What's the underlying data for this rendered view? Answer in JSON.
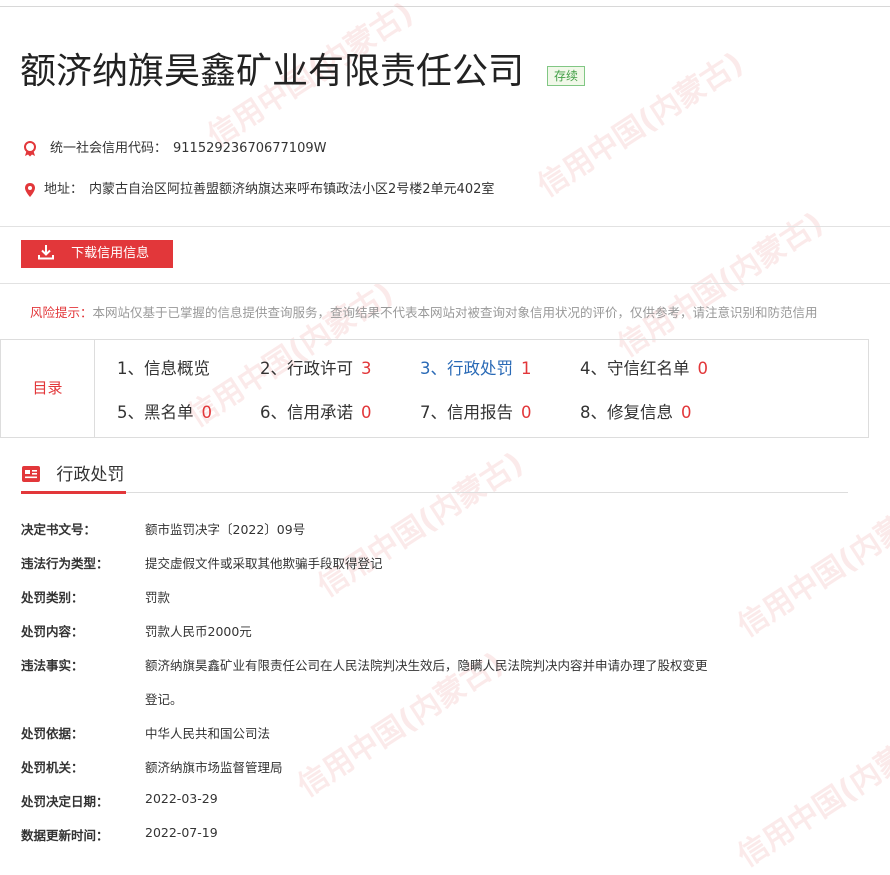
{
  "company": {
    "name": "额济纳旗昊鑫矿业有限责任公司",
    "status": "存续",
    "credit_code_label": "统一社会信用代码：",
    "credit_code": "91152923670677109W",
    "address_label": "地址：",
    "address": "内蒙古自治区阿拉善盟额济纳旗达来呼布镇政法小区2号楼2单元402室"
  },
  "actions": {
    "download_label": "下载信用信息"
  },
  "risk": {
    "label": "风险提示：",
    "text": "本网站仅基于已掌握的信息提供查询服务，查询结果不代表本网站对被查询对象信用状况的评价，仅供参考，请注意识别和防范信用"
  },
  "toc": {
    "label": "目录",
    "items": [
      {
        "label": "1、信息概览",
        "count": ""
      },
      {
        "label": "2、行政许可",
        "count": "3"
      },
      {
        "label": "3、行政处罚",
        "count": "1"
      },
      {
        "label": "4、守信红名单",
        "count": "0"
      },
      {
        "label": "5、黑名单",
        "count": "0"
      },
      {
        "label": "6、信用承诺",
        "count": "0"
      },
      {
        "label": "7、信用报告",
        "count": "0"
      },
      {
        "label": "8、修复信息",
        "count": "0"
      }
    ]
  },
  "section": {
    "title": "行政处罚",
    "fields": [
      {
        "label": "决定书文号：",
        "value": "额市监罚决字〔2022〕09号"
      },
      {
        "label": "违法行为类型：",
        "value": "提交虚假文件或采取其他欺骗手段取得登记"
      },
      {
        "label": "处罚类别：",
        "value": "罚款"
      },
      {
        "label": "处罚内容：",
        "value": "罚款人民币2000元"
      },
      {
        "label": "违法事实：",
        "value": "额济纳旗昊鑫矿业有限责任公司在人民法院判决生效后，隐瞒人民法院判决内容并申请办理了股权变更",
        "value_cont": "登记。"
      },
      {
        "label": "处罚依据：",
        "value": "中华人民共和国公司法"
      },
      {
        "label": "处罚机关：",
        "value": "额济纳旗市场监督管理局"
      },
      {
        "label": "处罚决定日期：",
        "value": "2022-03-29"
      },
      {
        "label": "数据更新时间：",
        "value": "2022-07-19"
      }
    ]
  },
  "watermark": {
    "text": "信用中国(内蒙古)"
  },
  "colors": {
    "accent": "#e2373a",
    "link": "#2a6ab6",
    "status_green": "#43a047"
  },
  "icons": {
    "credit": "ribbon-icon",
    "address": "location-pin-icon",
    "download": "download-icon",
    "section": "document-icon"
  }
}
